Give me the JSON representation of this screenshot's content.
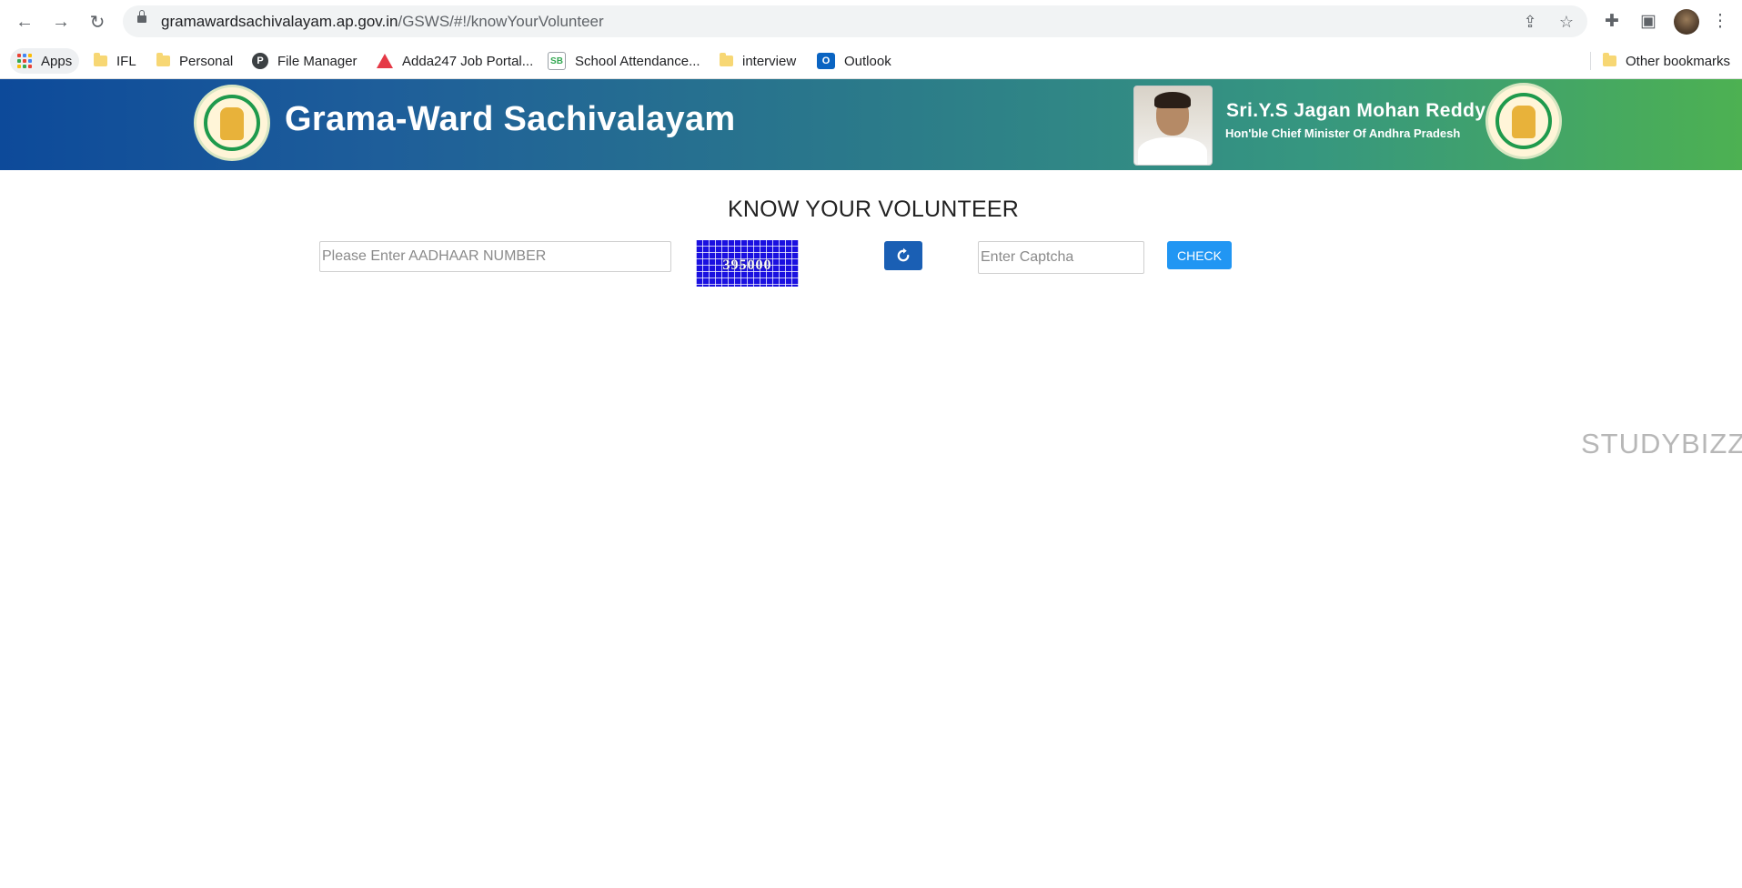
{
  "browser": {
    "url_host": "gramawardsachivalayam.ap.gov.in",
    "url_path": "/GSWS/#!/knowYourVolunteer",
    "bookmarks": [
      {
        "label": "Apps",
        "icon": "apps-grid-icon"
      },
      {
        "label": "IFL",
        "icon": "folder-icon"
      },
      {
        "label": "Personal",
        "icon": "folder-icon"
      },
      {
        "label": "File Manager",
        "icon": "file-manager-icon"
      },
      {
        "label": "Adda247 Job Portal...",
        "icon": "adda247-icon"
      },
      {
        "label": "School Attendance...",
        "icon": "school-attendance-icon"
      },
      {
        "label": "interview",
        "icon": "folder-icon"
      },
      {
        "label": "Outlook",
        "icon": "outlook-icon"
      }
    ],
    "other_bookmarks": "Other bookmarks"
  },
  "header": {
    "title": "Grama-Ward Sachivalayam",
    "cm_name": "Sri.Y.S Jagan Mohan Reddy",
    "cm_title": "Hon'ble Chief Minister Of Andhra Pradesh",
    "colors": {
      "gradient_start": "#0d4a9a",
      "gradient_end": "#4db152"
    }
  },
  "form": {
    "heading": "KNOW YOUR VOLUNTEER",
    "aadhaar_placeholder": "Please Enter AADHAAR NUMBER",
    "captcha_text": "395000",
    "captcha_placeholder": "Enter Captcha",
    "check_label": "CHECK",
    "colors": {
      "refresh": "#1a5fb4",
      "check": "#2196f3",
      "captcha_bg": "#1a10e0"
    }
  },
  "watermark": "STUDYBIZZ"
}
